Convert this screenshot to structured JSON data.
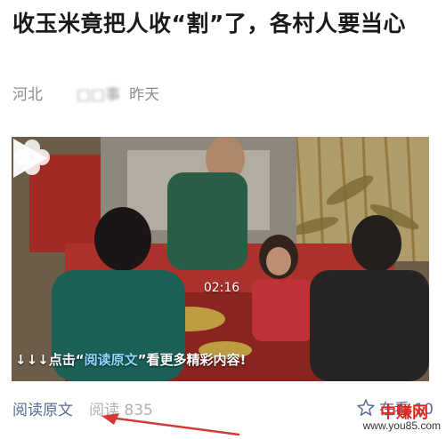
{
  "article": {
    "title": "收玉米竟把人收“割”了，各村人要当心",
    "source": "河北",
    "author": "□□事",
    "time": "昨天"
  },
  "video": {
    "duration": "02:16",
    "banner_prefix": "↓↓↓点击“",
    "banner_link": "阅读原文",
    "banner_suffix": "”看更多精彩内容!",
    "play_icon": "play-icon"
  },
  "footer": {
    "read_more": "阅读原文",
    "read_count_label": "阅读 835",
    "zaikan_label": "在看 10",
    "zaikan_icon": "star-icon"
  },
  "watermark": {
    "brand": "中赚网",
    "url": "www.you85.com"
  },
  "colors": {
    "link": "#576b95",
    "muted": "#b2b2b2",
    "arrow": "#d43a35"
  }
}
